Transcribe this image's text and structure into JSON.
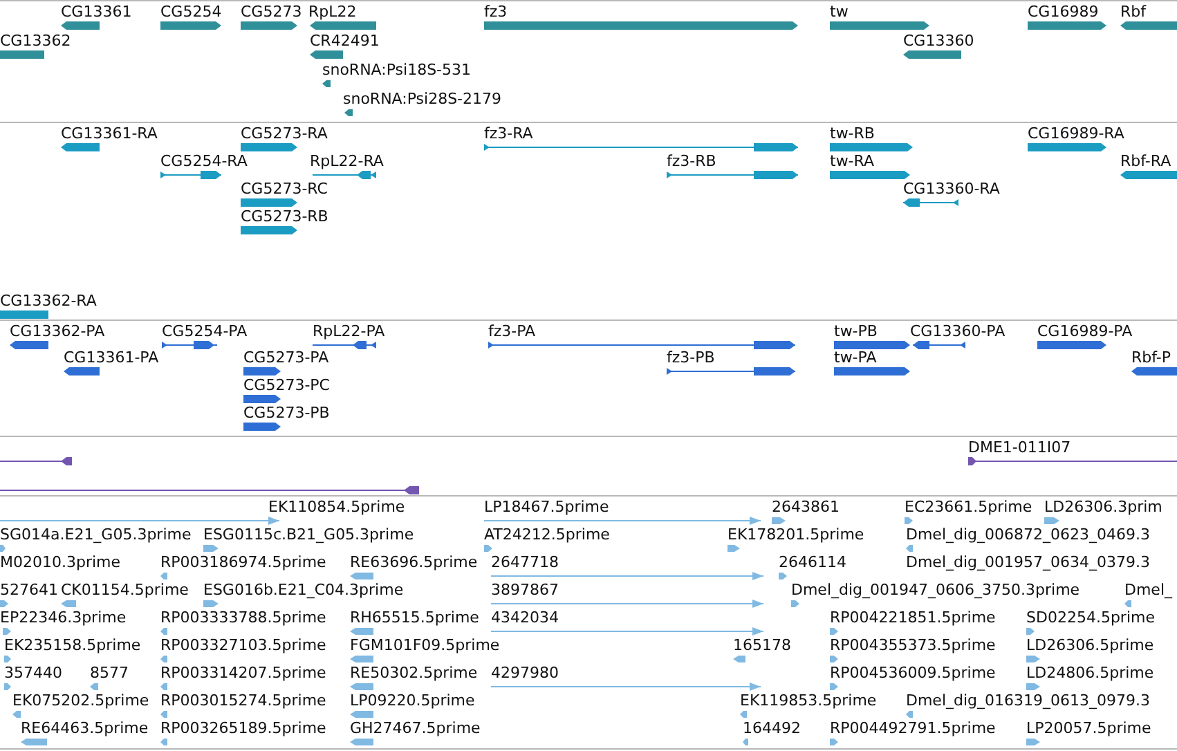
{
  "tracks": [
    {
      "color": "#30909a",
      "features": [
        {
          "label": "CG13361",
          "reverse": true,
          "kind": "gene"
        },
        {
          "label": "CG5254",
          "reverse": false,
          "kind": "gene"
        },
        {
          "label": "CG5273",
          "reverse": false,
          "kind": "gene"
        },
        {
          "label": "RpL22",
          "reverse": true,
          "kind": "gene"
        },
        {
          "label": "fz3",
          "reverse": false,
          "kind": "gene"
        },
        {
          "label": "tw",
          "reverse": false,
          "kind": "gene"
        },
        {
          "label": "CG16989",
          "reverse": false,
          "kind": "gene"
        },
        {
          "label": "Rbf",
          "reverse": true,
          "kind": "gene"
        },
        {
          "label": "CG13362",
          "reverse": true,
          "kind": "gene"
        },
        {
          "label": "CR42491",
          "reverse": true,
          "kind": "gene"
        },
        {
          "label": "CG13360",
          "reverse": true,
          "kind": "gene"
        },
        {
          "label": "snoRNA:Psi18S-531",
          "reverse": true,
          "kind": "read"
        },
        {
          "label": "snoRNA:Psi28S-2179",
          "reverse": true,
          "kind": "read"
        }
      ]
    },
    {
      "color": "#1b9cc2",
      "features": [
        {
          "label": "CG13361-RA",
          "reverse": true,
          "kind": "gene"
        },
        {
          "label": "CG5273-RA",
          "reverse": false,
          "kind": "gene"
        },
        {
          "label": "fz3-RA",
          "reverse": false,
          "kind": "transcript"
        },
        {
          "label": "tw-RB",
          "reverse": false,
          "kind": "gene"
        },
        {
          "label": "CG16989-RA",
          "reverse": false,
          "kind": "gene"
        },
        {
          "label": "CG5254-RA",
          "reverse": false,
          "kind": "transcript"
        },
        {
          "label": "RpL22-RA",
          "reverse": true,
          "kind": "transcript"
        },
        {
          "label": "fz3-RB",
          "reverse": false,
          "kind": "transcript"
        },
        {
          "label": "tw-RA",
          "reverse": false,
          "kind": "gene"
        },
        {
          "label": "Rbf-RA",
          "reverse": true,
          "kind": "gene"
        },
        {
          "label": "CG5273-RC",
          "reverse": false,
          "kind": "gene"
        },
        {
          "label": "CG13360-RA",
          "reverse": true,
          "kind": "transcript"
        },
        {
          "label": "CG5273-RB",
          "reverse": false,
          "kind": "gene"
        },
        {
          "label": "CG13362-RA",
          "reverse": true,
          "kind": "gene"
        }
      ]
    },
    {
      "color": "#2f6ed4",
      "features": [
        {
          "label": "CG13362-PA",
          "reverse": true,
          "kind": "gene"
        },
        {
          "label": "CG5254-PA",
          "reverse": false,
          "kind": "transcript"
        },
        {
          "label": "RpL22-PA",
          "reverse": true,
          "kind": "transcript"
        },
        {
          "label": "fz3-PA",
          "reverse": false,
          "kind": "transcript"
        },
        {
          "label": "tw-PB",
          "reverse": false,
          "kind": "gene"
        },
        {
          "label": "CG13360-PA",
          "reverse": true,
          "kind": "transcript"
        },
        {
          "label": "CG16989-PA",
          "reverse": false,
          "kind": "gene"
        },
        {
          "label": "CG13361-PA",
          "reverse": true,
          "kind": "gene"
        },
        {
          "label": "CG5273-PA",
          "reverse": false,
          "kind": "gene"
        },
        {
          "label": "fz3-PB",
          "reverse": false,
          "kind": "transcript"
        },
        {
          "label": "tw-PA",
          "reverse": false,
          "kind": "gene"
        },
        {
          "label": "Rbf-P",
          "reverse": true,
          "kind": "gene"
        },
        {
          "label": "CG5273-PC",
          "reverse": false,
          "kind": "gene"
        },
        {
          "label": "CG5273-PB",
          "reverse": false,
          "kind": "gene"
        }
      ]
    },
    {
      "color": "#7256b0",
      "features": [
        {
          "reverse": true,
          "kind": "transcript"
        },
        {
          "reverse": true,
          "kind": "transcript"
        },
        {
          "label": "DME1-011I07",
          "reverse": false,
          "kind": "transcript"
        }
      ]
    },
    {
      "color": "#80b9e2",
      "features": [
        {
          "label": "EK110854.5prime",
          "reverse": false,
          "kind": "span"
        },
        {
          "label": "LP18467.5prime",
          "reverse": false,
          "kind": "span"
        },
        {
          "label": "2643861",
          "reverse": false,
          "kind": "read"
        },
        {
          "label": "EC23661.5prime",
          "reverse": false,
          "kind": "read"
        },
        {
          "label": "LD26306.3prim",
          "reverse": false,
          "kind": "read"
        },
        {
          "label": "SG014a.E21_G05.3prime",
          "reverse": false,
          "kind": "read"
        },
        {
          "label": "ESG0115c.B21_G05.3prime",
          "reverse": false,
          "kind": "read"
        },
        {
          "label": "AT24212.5prime",
          "reverse": false,
          "kind": "read"
        },
        {
          "label": "EK178201.5prime",
          "reverse": false,
          "kind": "read"
        },
        {
          "label": "Dmel_dig_006872_0623_0469.3",
          "reverse": true,
          "kind": "read"
        },
        {
          "label": "M02010.3prime"
        },
        {
          "label": "RP003186974.5prime",
          "reverse": true,
          "kind": "read"
        },
        {
          "label": "RE63696.5prime",
          "reverse": true,
          "kind": "read"
        },
        {
          "label": "2647718",
          "reverse": false,
          "kind": "span"
        },
        {
          "label": "2646114",
          "reverse": false,
          "kind": "read"
        },
        {
          "label": "Dmel_dig_001957_0634_0379.3"
        },
        {
          "label": "527641",
          "reverse": false,
          "kind": "read"
        },
        {
          "label": "CK01154.5prime",
          "reverse": true,
          "kind": "read"
        },
        {
          "label": "ESG016b.E21_C04.3prime",
          "reverse": false,
          "kind": "read"
        },
        {
          "label": "3897867",
          "reverse": false,
          "kind": "span"
        },
        {
          "label": "Dmel_dig_001947_0606_3750.3prime",
          "reverse": false,
          "kind": "read"
        },
        {
          "label": "Dmel_",
          "reverse": true,
          "kind": "read"
        },
        {
          "label": "EP22346.3prime",
          "reverse": false,
          "kind": "read"
        },
        {
          "label": "RP003333788.5prime",
          "reverse": true,
          "kind": "read"
        },
        {
          "label": "RH65515.5prime",
          "reverse": true,
          "kind": "read"
        },
        {
          "label": "4342034",
          "reverse": false,
          "kind": "span"
        },
        {
          "label": "RP004221851.5prime",
          "reverse": false,
          "kind": "read"
        },
        {
          "label": "SD02254.5prime",
          "reverse": false,
          "kind": "read"
        },
        {
          "label": "EK235158.5prime",
          "reverse": false,
          "kind": "read"
        },
        {
          "label": "RP003327103.5prime",
          "reverse": true,
          "kind": "read"
        },
        {
          "label": "FGM101F09.5prime",
          "reverse": true,
          "kind": "read"
        },
        {
          "label": "165178",
          "reverse": true,
          "kind": "read"
        },
        {
          "label": "RP004355373.5prime",
          "reverse": false,
          "kind": "read"
        },
        {
          "label": "LD26306.5prime",
          "reverse": false,
          "kind": "read"
        },
        {
          "label": "357440",
          "reverse": false,
          "kind": "read"
        },
        {
          "label": "8577",
          "reverse": true,
          "kind": "read"
        },
        {
          "label": "RP003314207.5prime",
          "reverse": true,
          "kind": "read"
        },
        {
          "label": "RE50302.5prime",
          "reverse": true,
          "kind": "read"
        },
        {
          "label": "4297980",
          "reverse": false,
          "kind": "span"
        },
        {
          "label": "RP004536009.5prime",
          "reverse": false,
          "kind": "read"
        },
        {
          "label": "LD24806.5prime",
          "reverse": false,
          "kind": "read"
        },
        {
          "label": "EK075202.5prime",
          "reverse": true,
          "kind": "read"
        },
        {
          "label": "RP003015274.5prime",
          "reverse": true,
          "kind": "read"
        },
        {
          "label": "LP09220.5prime",
          "reverse": true,
          "kind": "read"
        },
        {
          "label": "EK119853.5prime",
          "reverse": true,
          "kind": "read"
        },
        {
          "label": "Dmel_dig_016319_0613_0979.3",
          "reverse": true,
          "kind": "read"
        },
        {
          "label": "RE64463.5prime",
          "reverse": true,
          "kind": "read"
        },
        {
          "label": "RP003265189.5prime",
          "reverse": true,
          "kind": "read"
        },
        {
          "label": "GH27467.5prime",
          "reverse": true,
          "kind": "read"
        },
        {
          "label": "164492",
          "reverse": true,
          "kind": "read"
        },
        {
          "label": "RP004492791.5prime",
          "reverse": false,
          "kind": "read"
        },
        {
          "label": "LP20057.5prime",
          "reverse": false,
          "kind": "read"
        }
      ]
    }
  ]
}
